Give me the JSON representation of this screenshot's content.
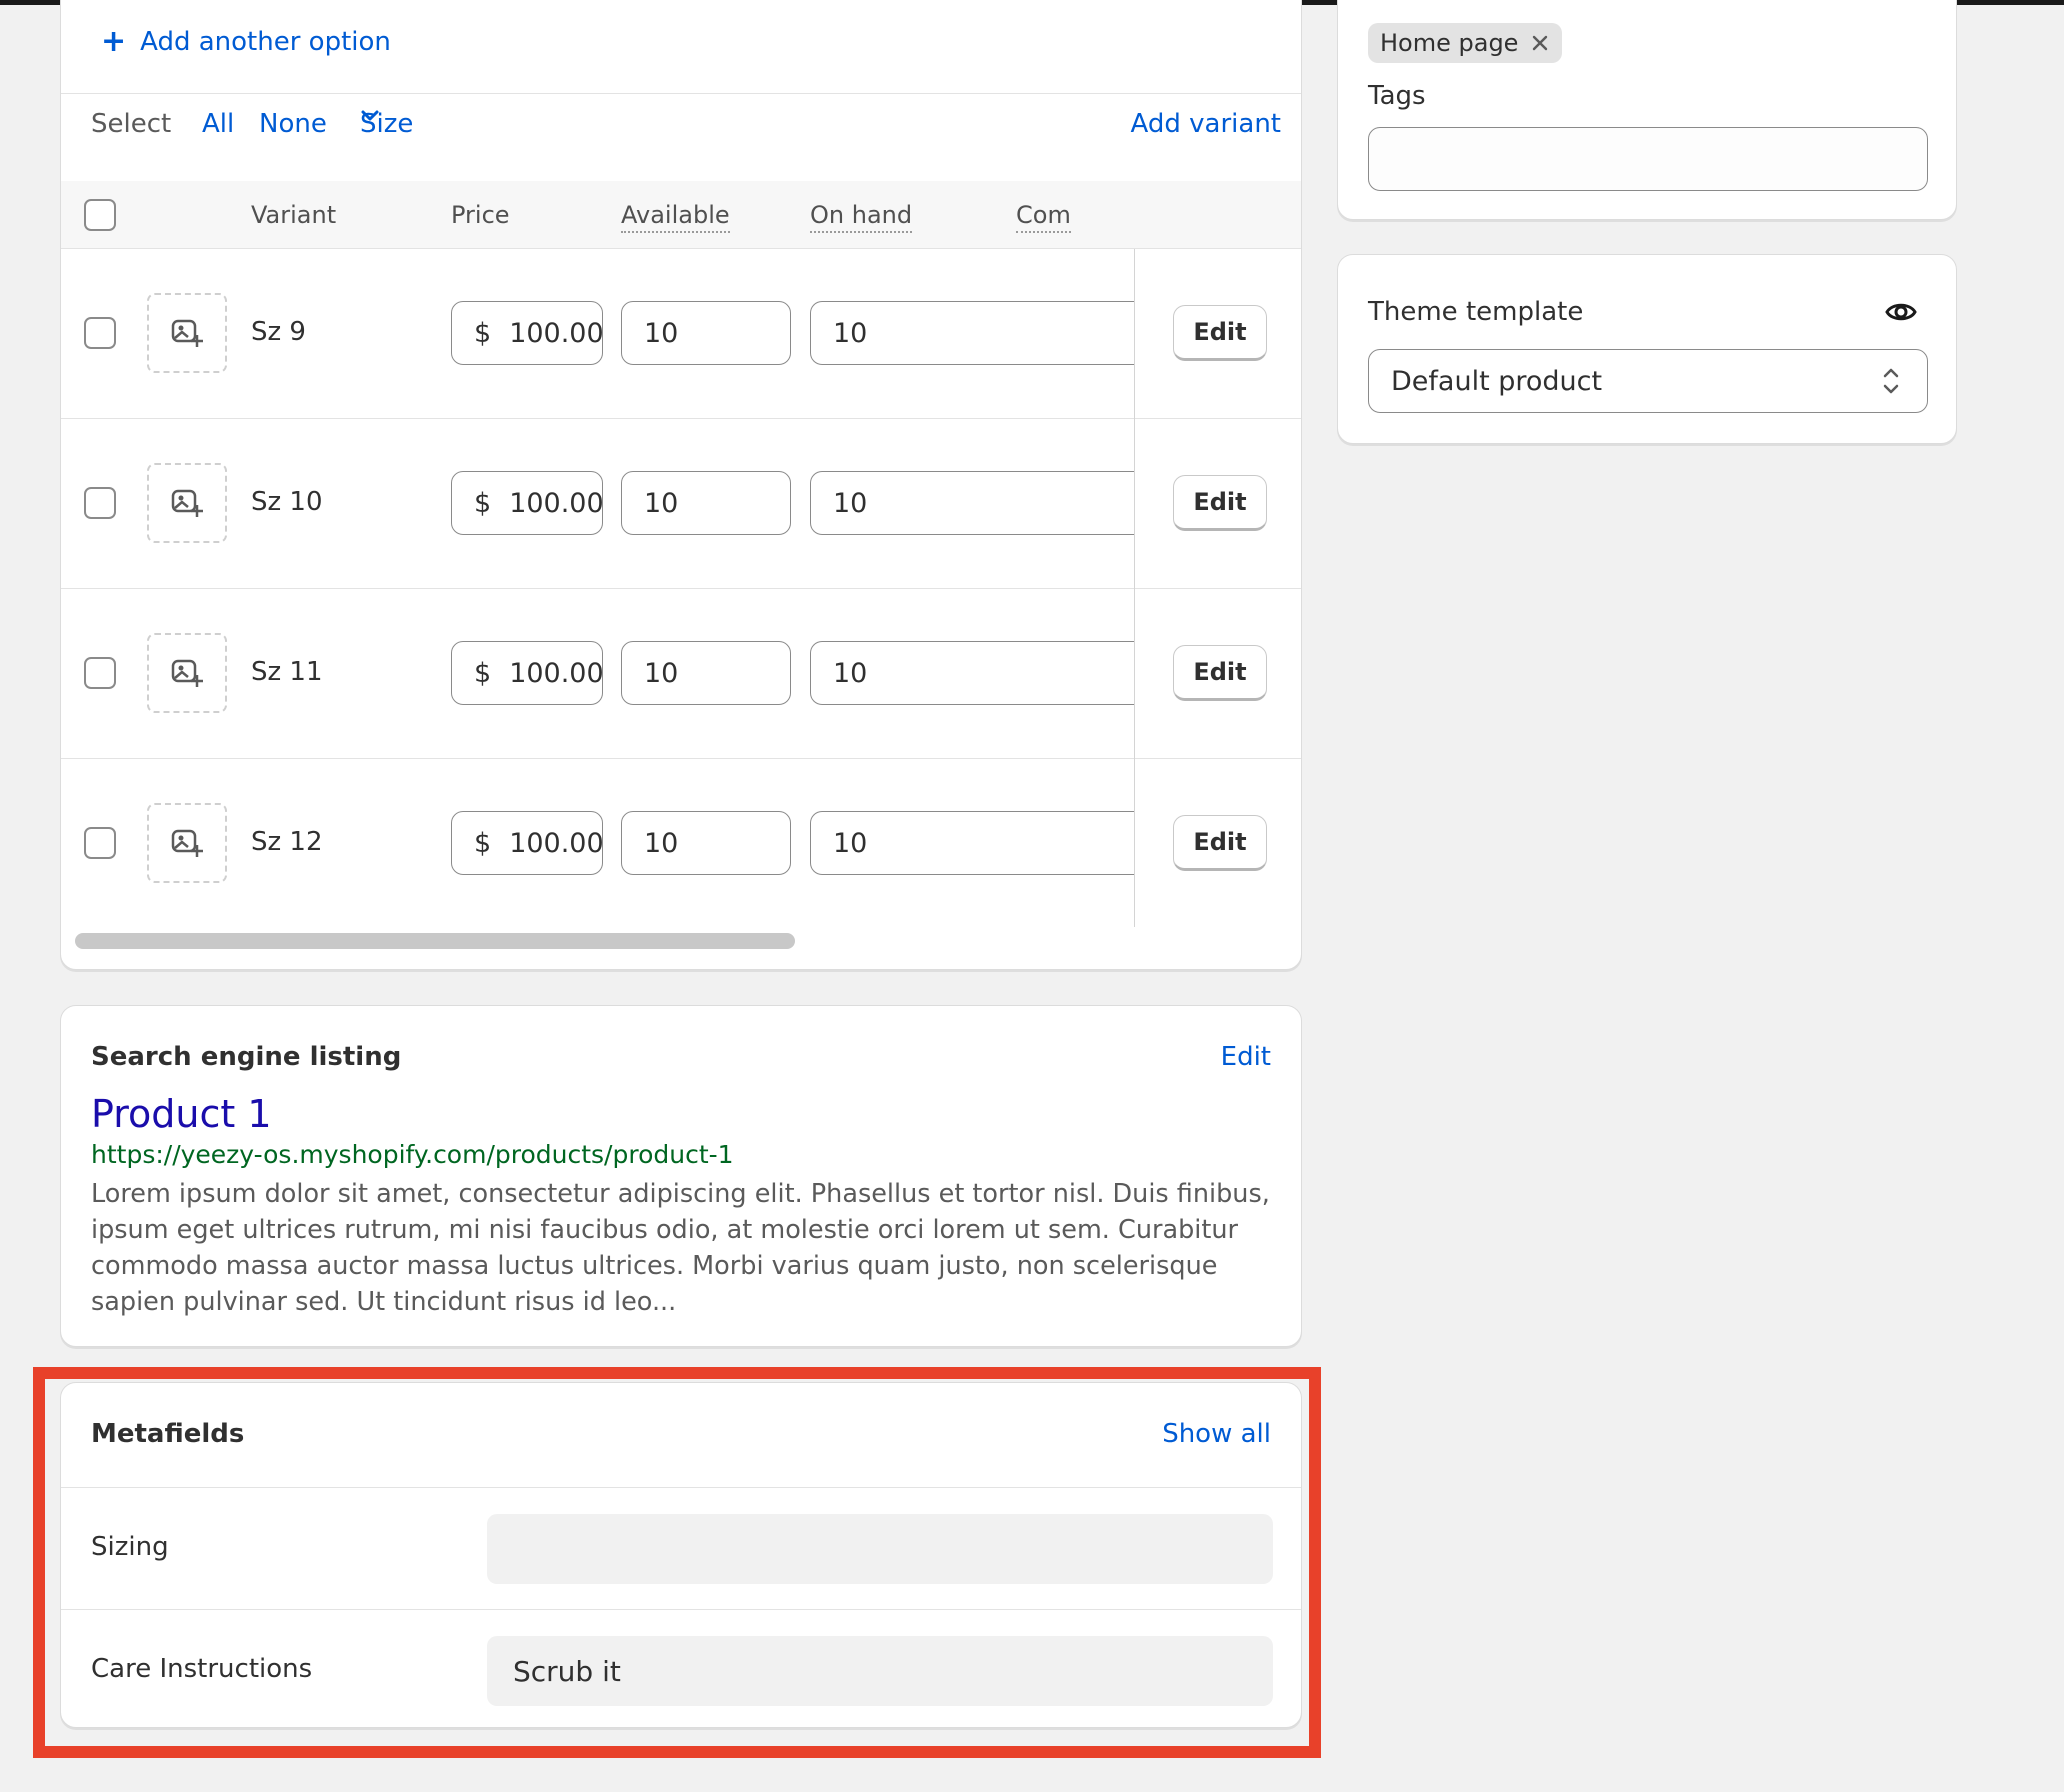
{
  "variants": {
    "add_option_label": "Add another option",
    "select_bar": {
      "select_label": "Select",
      "all_label": "All",
      "none_label": "None",
      "size_label": "Size",
      "add_variant_label": "Add variant"
    },
    "columns": {
      "variant": "Variant",
      "price": "Price",
      "available": "Available",
      "on_hand": "On hand",
      "committed_partial": "Com"
    },
    "rows": [
      {
        "name": "Sz 9",
        "currency": "$",
        "price": "100.00",
        "available": "10",
        "on_hand": "10",
        "edit": "Edit"
      },
      {
        "name": "Sz 10",
        "currency": "$",
        "price": "100.00",
        "available": "10",
        "on_hand": "10",
        "edit": "Edit"
      },
      {
        "name": "Sz 11",
        "currency": "$",
        "price": "100.00",
        "available": "10",
        "on_hand": "10",
        "edit": "Edit"
      },
      {
        "name": "Sz 12",
        "currency": "$",
        "price": "100.00",
        "available": "10",
        "on_hand": "10",
        "edit": "Edit"
      }
    ]
  },
  "seo": {
    "heading": "Search engine listing",
    "edit_label": "Edit",
    "title": "Product 1",
    "url": "https://yeezy-os.myshopify.com/products/product-1",
    "description": "Lorem ipsum dolor sit amet, consectetur adipiscing elit. Phasellus et tortor nisl. Duis finibus, ipsum eget ultrices rutrum, mi nisi faucibus odio, at molestie orci lorem ut sem. Curabitur commodo massa auctor massa luctus ultrices. Morbi varius quam justo, non scelerisque sapien pulvinar sed. Ut tincidunt risus id leo..."
  },
  "metafields": {
    "heading": "Metafields",
    "show_all_label": "Show all",
    "fields": [
      {
        "label": "Sizing",
        "value": ""
      },
      {
        "label": "Care Instructions",
        "value": "Scrub it"
      }
    ]
  },
  "organization": {
    "collection_chip": "Home page",
    "tags_label": "Tags",
    "tags_value": ""
  },
  "theme": {
    "label": "Theme template",
    "selected": "Default product"
  },
  "colors": {
    "accent_link": "#005bd3",
    "seo_title": "#1a0dab",
    "seo_url": "#006621",
    "highlight_border": "#e8412a"
  },
  "icons": {
    "add_option": "plus-icon",
    "size_dropdown": "chevron-down-icon",
    "variant_image": "image-add-icon",
    "chip_remove": "close-icon",
    "theme_preview": "eye-icon",
    "theme_select": "select-updown-icon"
  }
}
